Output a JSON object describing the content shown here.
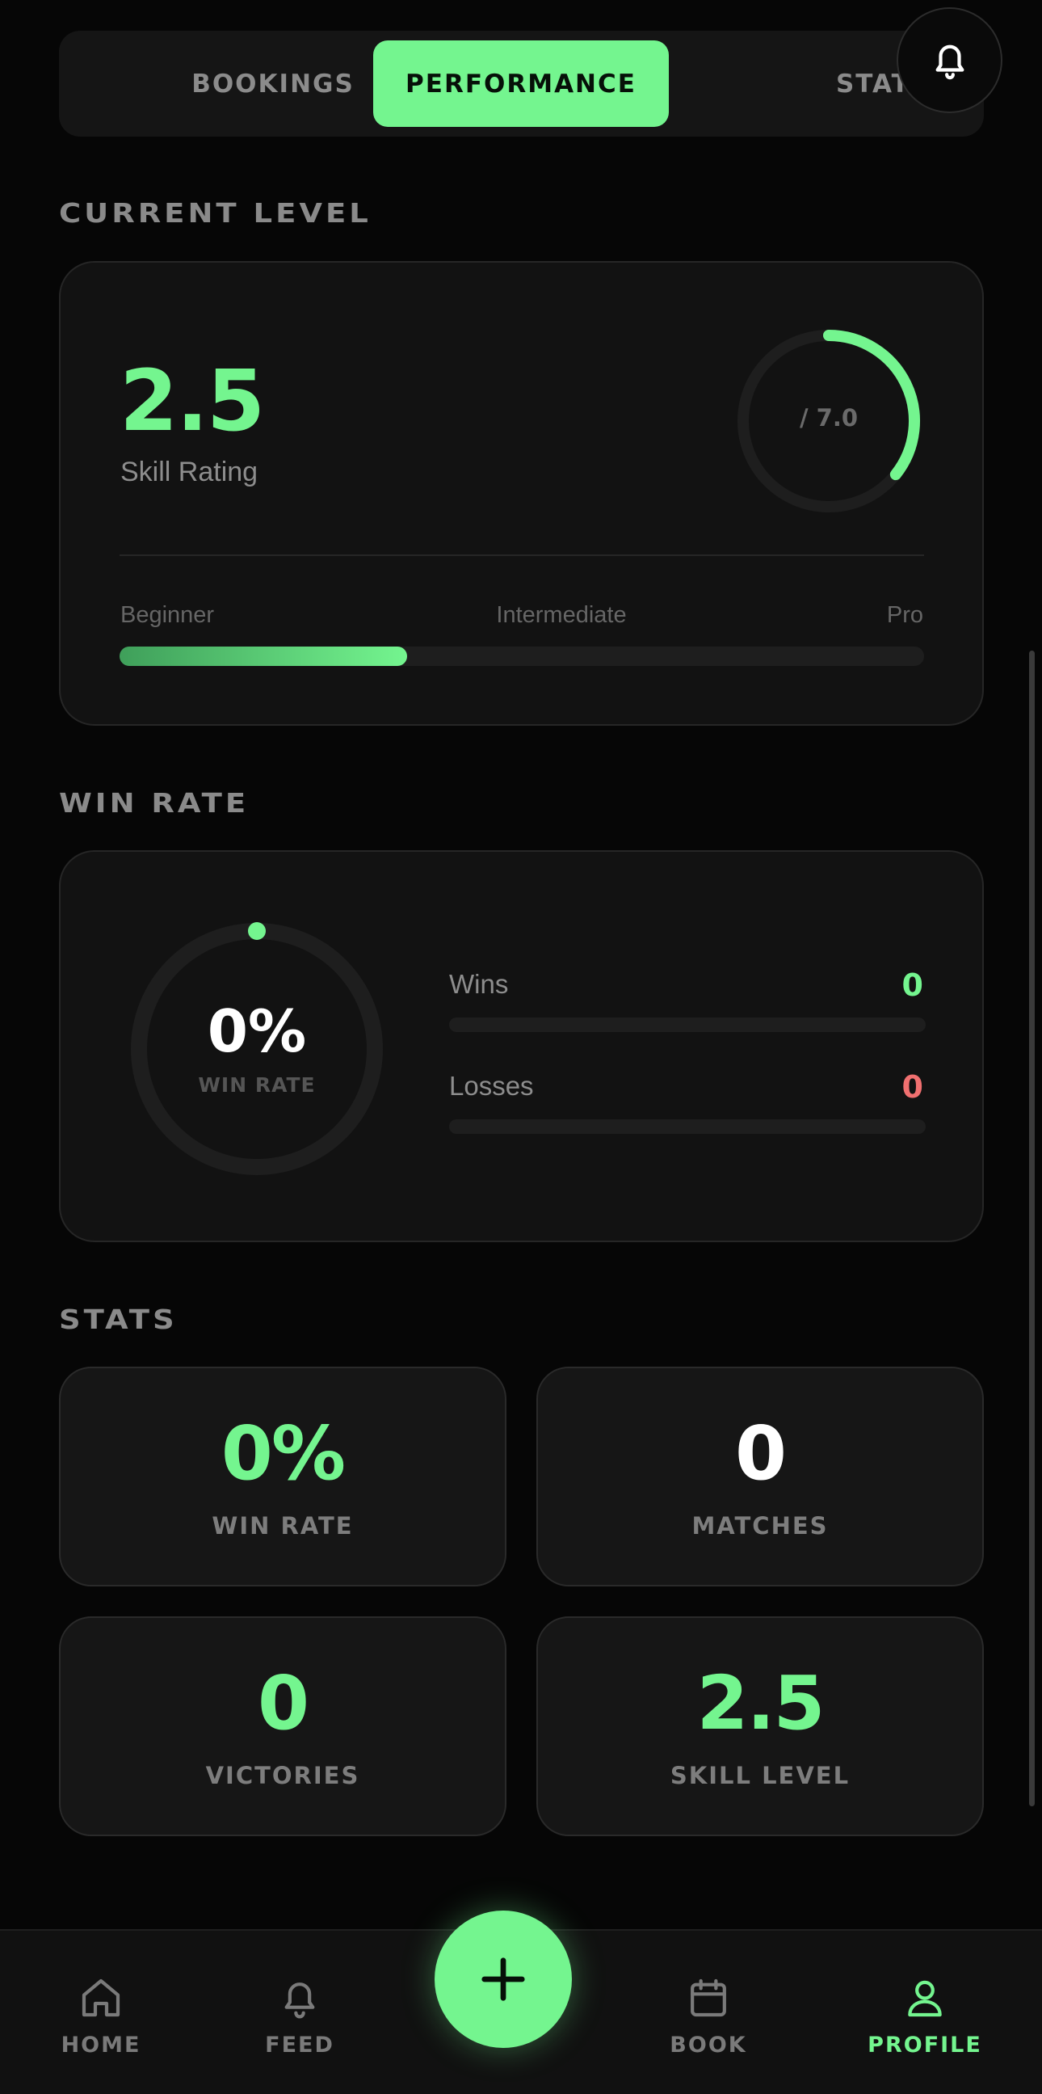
{
  "tabs": [
    {
      "label": "BOOKINGS",
      "active": false
    },
    {
      "label": "PERFORMANCE",
      "active": true
    },
    {
      "label": "STATS",
      "active": false
    }
  ],
  "current_level": {
    "section_title": "CURRENT LEVEL",
    "rating": "2.5",
    "rating_label": "Skill Rating",
    "ring_label": "/ 7.0",
    "rating_value": 2.5,
    "rating_max": 7.0,
    "scale_labels": [
      "Beginner",
      "Intermediate",
      "Pro"
    ],
    "progress_fraction": 0.357
  },
  "win_rate": {
    "section_title": "WIN RATE",
    "percent_text": "0%",
    "ring_caption": "WIN RATE",
    "wins_label": "Wins",
    "wins_value": "0",
    "losses_label": "Losses",
    "losses_value": "0"
  },
  "stats": {
    "section_title": "STATS",
    "cards": [
      {
        "value": "0%",
        "label": "WIN RATE",
        "accent": true
      },
      {
        "value": "0",
        "label": "MATCHES",
        "accent": false
      },
      {
        "value": "0",
        "label": "VICTORIES",
        "accent": true
      },
      {
        "value": "2.5",
        "label": "SKILL LEVEL",
        "accent": true
      }
    ]
  },
  "nav": {
    "items": [
      {
        "label": "HOME",
        "icon": "home-icon"
      },
      {
        "label": "FEED",
        "icon": "bell-icon"
      },
      {
        "label": "BOOK",
        "icon": "calendar-icon"
      },
      {
        "label": "PROFILE",
        "icon": "user-icon",
        "active": true
      }
    ]
  },
  "colors": {
    "accent": "#74f58f",
    "loss": "#f07070",
    "background": "#060606",
    "card": "#121212"
  }
}
